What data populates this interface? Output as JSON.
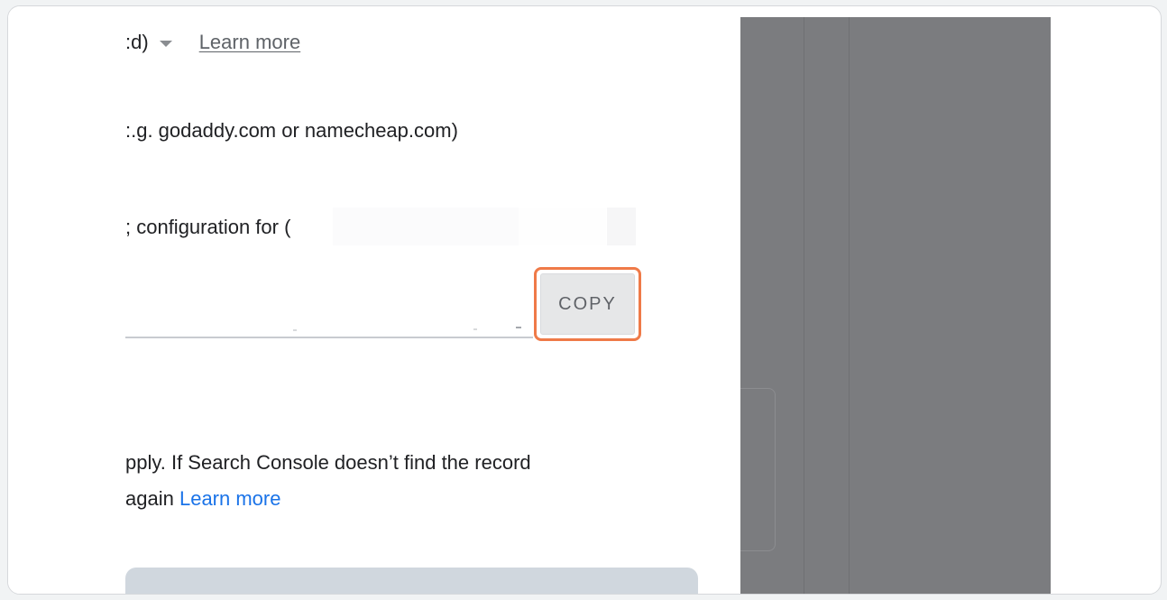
{
  "dialog": {
    "dropdown_partial_text": ":d)",
    "learn_more_top": "Learn more",
    "registrar_hint": ":.g. godaddy.com or namecheap.com)",
    "configuration_partial": "; configuration for (",
    "copy_button": "COPY",
    "verification_text": "pply. If Search Console doesn’t find the record",
    "verification_text_line2": "again",
    "learn_more_bottom": "Learn more"
  },
  "colors": {
    "highlight": "#ef7a48",
    "link": "#1a73e8",
    "muted_text": "#5f6368",
    "overlay": "#7b7c7f"
  }
}
